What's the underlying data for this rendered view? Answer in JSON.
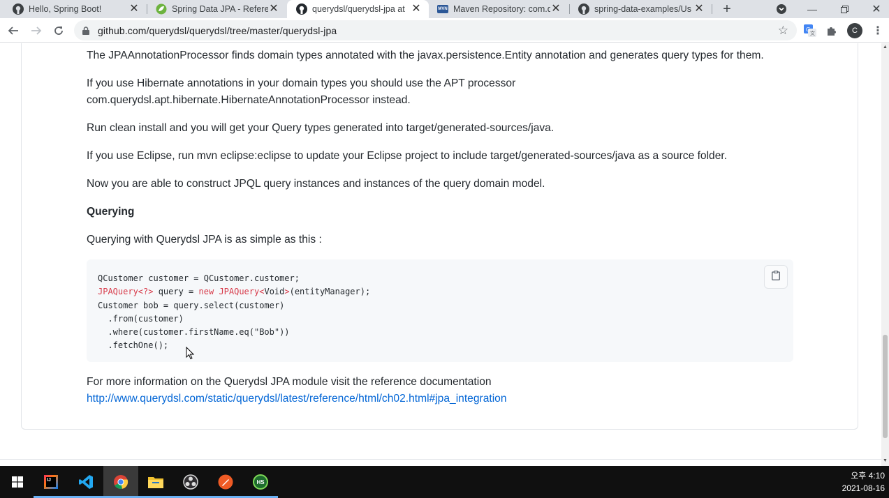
{
  "browser": {
    "tabs": [
      {
        "title": "Hello, Spring Boot!",
        "icon": "github-icon"
      },
      {
        "title": "Spring Data JPA - Reference",
        "icon": "spring-icon"
      },
      {
        "title": "querydsl/querydsl-jpa at",
        "icon": "github-icon"
      },
      {
        "title": "Maven Repository: com.q",
        "icon": "mvn-icon"
      },
      {
        "title": "spring-data-examples/Us",
        "icon": "github-icon"
      }
    ],
    "active_tab_index": 2,
    "new_tab_label": "+",
    "url": "github.com/querydsl/querydsl/tree/master/querydsl-jpa",
    "profile_initial": "C"
  },
  "readme": {
    "para1": "The JPAAnnotationProcessor finds domain types annotated with the javax.persistence.Entity annotation and generates query types for them.",
    "para2_line1": "If you use Hibernate annotations in your domain types you should use the APT processor",
    "para2_line2": "com.querydsl.apt.hibernate.HibernateAnnotationProcessor instead.",
    "para3": "Run clean install and you will get your Query types generated into target/generated-sources/java.",
    "para4": "If you use Eclipse, run mvn eclipse:eclipse to update your Eclipse project to include target/generated-sources/java as a source folder.",
    "para5": "Now you are able to construct JPQL query instances and instances of the query domain model.",
    "heading": "Querying",
    "para6": "Querying with Querydsl JPA is as simple as this :",
    "code": [
      "QCustomer customer = QCustomer.customer;",
      "JPAQuery<?> query = new JPAQuery<Void>(entityManager);",
      "Customer bob = query.select(customer)",
      "  .from(customer)",
      "  .where(customer.firstName.eq(\"Bob\"))",
      "  .fetchOne();"
    ],
    "para7": "For more information on the Querydsl JPA module visit the reference documentation",
    "link": "http://www.querydsl.com/static/querydsl/latest/reference/html/ch02.html#jpa_integration"
  },
  "taskbar": {
    "apps": [
      "start-icon",
      "intellij-icon",
      "vscode-icon",
      "chrome-icon",
      "file-explorer-icon",
      "obs-icon",
      "postman-icon",
      "hs-icon"
    ],
    "hs_label": "HS",
    "ij_label": "IJ",
    "time": "오후 4:10",
    "date": "2021-08-16"
  }
}
